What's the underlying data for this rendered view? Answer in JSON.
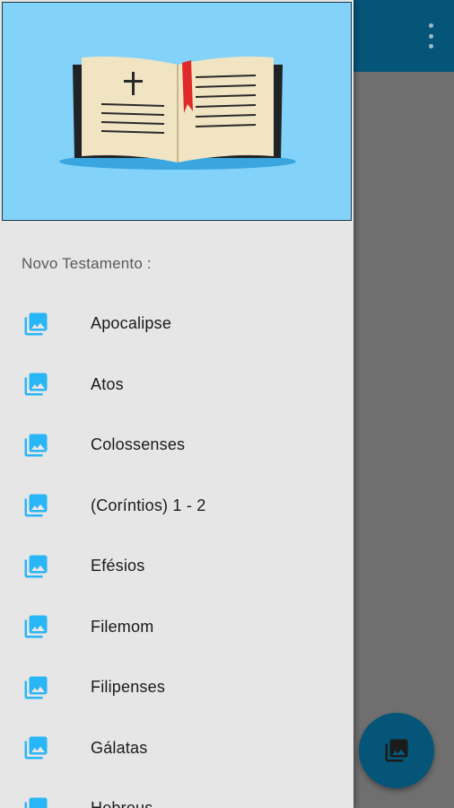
{
  "app": {
    "overflow_icon": "more-vert-icon",
    "fab_icon": "photo-library-icon",
    "colors": {
      "appbar": "#045578",
      "scrim": "#6f6f6f",
      "drawer_bg": "#e6e6e6",
      "header_bg": "#82d2f9",
      "icon_accent": "#29b6f6"
    }
  },
  "drawer": {
    "header_image": "open-bible-illustration",
    "section_title": "Novo Testamento :",
    "items": [
      {
        "label": "Apocalipse",
        "icon": "photo-library-icon"
      },
      {
        "label": "Atos",
        "icon": "photo-library-icon"
      },
      {
        "label": "Colossenses",
        "icon": "photo-library-icon"
      },
      {
        "label": "(Coríntios) 1 - 2",
        "icon": "photo-library-icon"
      },
      {
        "label": "Efésios",
        "icon": "photo-library-icon"
      },
      {
        "label": "Filemom",
        "icon": "photo-library-icon"
      },
      {
        "label": "Filipenses",
        "icon": "photo-library-icon"
      },
      {
        "label": "Gálatas",
        "icon": "photo-library-icon"
      },
      {
        "label": "Hebreus",
        "icon": "photo-library-icon"
      }
    ]
  }
}
